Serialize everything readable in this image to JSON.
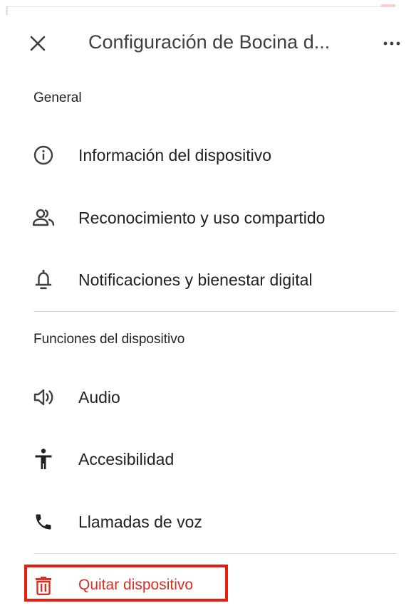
{
  "header": {
    "title": "Configuración de Bocina d...",
    "close_icon": "close-icon",
    "more_icon": "more-horizontal-icon"
  },
  "sections": {
    "general": {
      "title": "General",
      "items": [
        {
          "label": "Información del dispositivo",
          "icon": "info-icon"
        },
        {
          "label": "Reconocimiento y uso compartido",
          "icon": "people-icon"
        },
        {
          "label": "Notificaciones y bienestar digital",
          "icon": "bell-icon"
        }
      ]
    },
    "device_features": {
      "title": "Funciones del dispositivo",
      "items": [
        {
          "label": "Audio",
          "icon": "speaker-icon"
        },
        {
          "label": "Accesibilidad",
          "icon": "accessibility-icon"
        },
        {
          "label": "Llamadas de voz",
          "icon": "phone-icon"
        }
      ]
    }
  },
  "remove": {
    "label": "Quitar dispositivo",
    "icon": "trash-icon",
    "color": "#d93025",
    "highlight_color": "#ea1c0d"
  }
}
